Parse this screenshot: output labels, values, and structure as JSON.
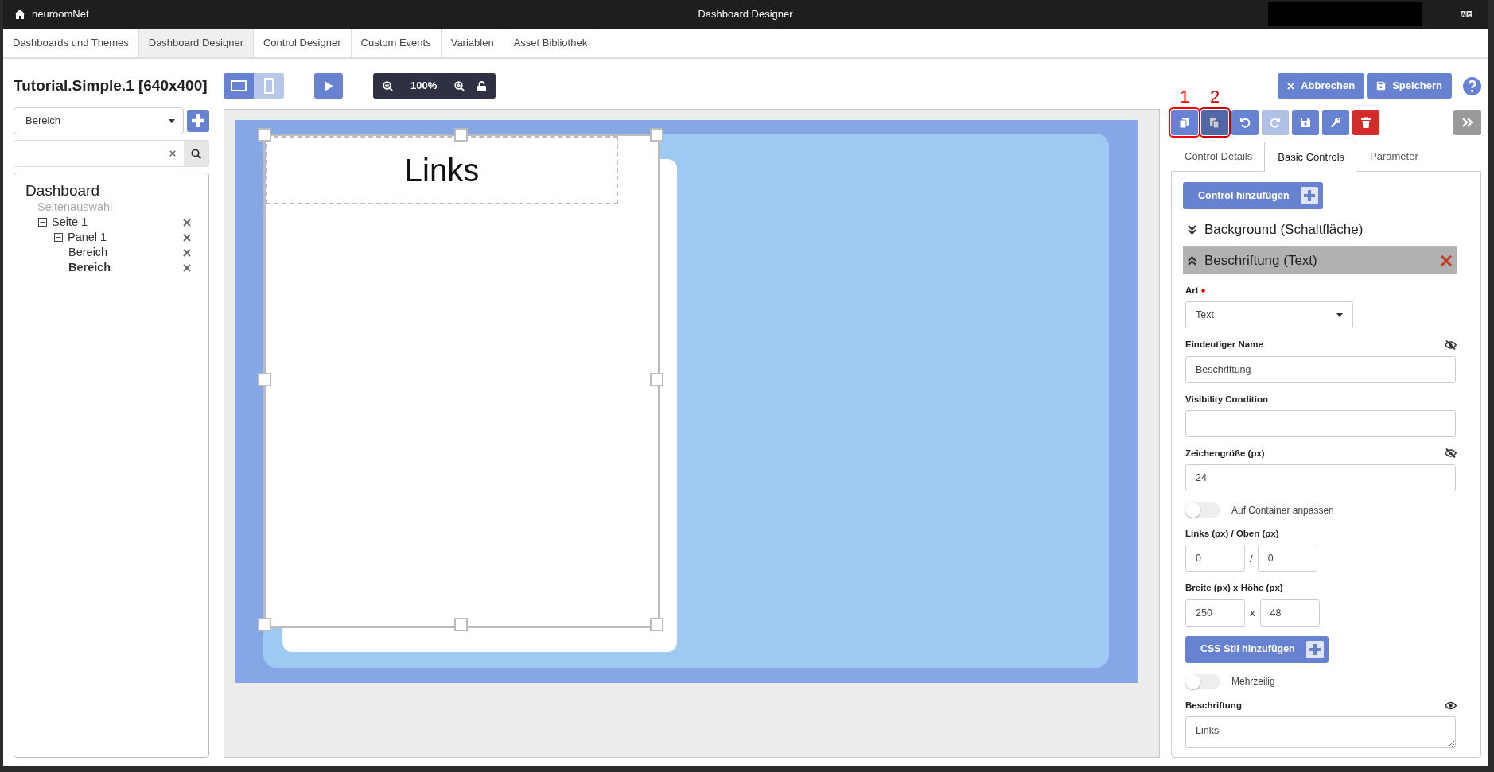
{
  "top_bar": {
    "brand": "neuroomNet",
    "title": "Dashboard Designer"
  },
  "nav_tabs": [
    {
      "label": "Dashboards und Themes",
      "selected": false
    },
    {
      "label": "Dashboard Designer",
      "selected": true
    },
    {
      "label": "Control Designer",
      "selected": false
    },
    {
      "label": "Custom Events",
      "selected": false
    },
    {
      "label": "Variablen",
      "selected": false
    },
    {
      "label": "Asset Bibliothek",
      "selected": false
    }
  ],
  "left_panel": {
    "title": "Tutorial.Simple.1 [640x400]",
    "type_select": {
      "value": "Bereich"
    },
    "tree": {
      "label": "Dashboard",
      "children": [
        {
          "label": "Seitenauswahl",
          "kind": "section"
        },
        {
          "label": "Seite 1",
          "kind": "node",
          "expanded": true,
          "selected": false,
          "children": [
            {
              "label": "Panel 1",
              "kind": "node",
              "expanded": true,
              "selected": false,
              "children": [
                {
                  "label": "Bereich",
                  "kind": "node",
                  "selected": false
                },
                {
                  "label": "Bereich",
                  "kind": "node",
                  "selected": true
                }
              ]
            }
          ]
        }
      ]
    }
  },
  "toolbar": {
    "view_modes": [
      {
        "kind": "landscape",
        "selected": true
      },
      {
        "kind": "portrait",
        "selected": false
      }
    ],
    "zoom": "100%",
    "locked": false
  },
  "canvas": {
    "text_element": "Links"
  },
  "right_panel": {
    "cancel": "Abbrechen",
    "save": "Speichern",
    "tools": [
      {
        "kind": "copy",
        "disabled": false,
        "pressed": false,
        "marker": "1"
      },
      {
        "kind": "paste",
        "disabled": false,
        "pressed": true,
        "marker": "2"
      },
      {
        "kind": "undo",
        "disabled": false,
        "pressed": false
      },
      {
        "kind": "redo",
        "disabled": true,
        "pressed": false
      },
      {
        "kind": "save",
        "disabled": false,
        "pressed": false
      },
      {
        "kind": "key",
        "disabled": false,
        "pressed": false
      },
      {
        "kind": "delete",
        "disabled": false,
        "pressed": false
      }
    ],
    "tabs": [
      {
        "label": "Control Details",
        "selected": false
      },
      {
        "label": "Basic Controls",
        "selected": true
      },
      {
        "label": "Parameter",
        "selected": false
      }
    ],
    "add_control": "Control hinzufügen",
    "sections": [
      {
        "title": "Background (Schaltfläche)",
        "expanded": false
      },
      {
        "title": "Beschriftung (Text)",
        "expanded": true
      }
    ],
    "fields": [
      {
        "kind": "select",
        "label": "Art",
        "required": true,
        "value": "Text"
      },
      {
        "kind": "text",
        "label": "Eindeutiger Name",
        "value": "Beschriftung",
        "visible": false
      },
      {
        "kind": "text",
        "label": "Visibility Condition"
      },
      {
        "kind": "text",
        "label": "Zeichengröße (px)",
        "value": "24",
        "visible": false
      },
      {
        "kind": "toggle",
        "label": "Auf Container anpassen",
        "on": false
      },
      {
        "kind": "pair",
        "label": "Links (px) / Oben (px)",
        "separator": "/",
        "values": [
          "0",
          "0"
        ]
      },
      {
        "kind": "pair",
        "label": "Breite (px) x Höhe (px)",
        "separator": "x",
        "values": [
          "250",
          "48"
        ]
      },
      {
        "kind": "button",
        "label": "CSS Stil hinzufügen"
      },
      {
        "kind": "toggle",
        "label": "Mehrzeilig",
        "on": false
      },
      {
        "kind": "textarea",
        "label": "Beschriftung",
        "value": "Links",
        "visible": true
      }
    ]
  }
}
